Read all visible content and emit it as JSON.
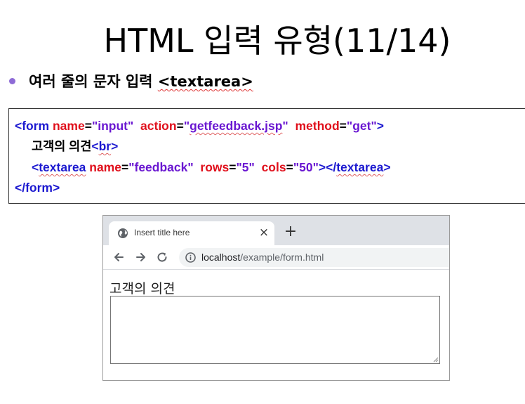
{
  "slide": {
    "title": "HTML 입력 유형(11/14)",
    "bullet": {
      "text_prefix": "여러 줄의 문자 입력 ",
      "tag": "<textarea>"
    }
  },
  "code": {
    "line1": {
      "open": "<form",
      "attr1": "name",
      "eq1": "=",
      "val1": "\"input\"",
      "attr2": "action",
      "eq2": "=",
      "val2_q1": "\"",
      "val2": "getfeedback.jsp",
      "val2_q2": "\"",
      "attr3": "method",
      "eq3": "=",
      "val3": "\"get\"",
      "close": ">"
    },
    "line2": {
      "text": "고객의 의견",
      "br_open": "<",
      "br": "br",
      "br_close": ">"
    },
    "line3": {
      "open_lt": "<",
      "open": "textarea",
      "attr1": "name",
      "eq1": "=",
      "val1": "\"feedback\"",
      "attr2": "rows",
      "eq2": "=",
      "val2": "\"5\"",
      "attr3": "cols",
      "eq3": "=",
      "val3": "\"50\"",
      "close": "></",
      "close_tag": "textarea",
      "close_end": ">"
    },
    "line4": {
      "text": "</form>"
    }
  },
  "browser": {
    "tab_title": "Insert title here",
    "tab_close": "×",
    "new_tab": "+",
    "url_host": "localhost",
    "url_path": "/example/form.html",
    "page_label": "고객의 의견",
    "textarea_value": ""
  },
  "colors": {
    "tag": "#1c19d0",
    "attr": "#e0101c",
    "value": "#6a17d1",
    "bullet": "#8e6bd6"
  }
}
